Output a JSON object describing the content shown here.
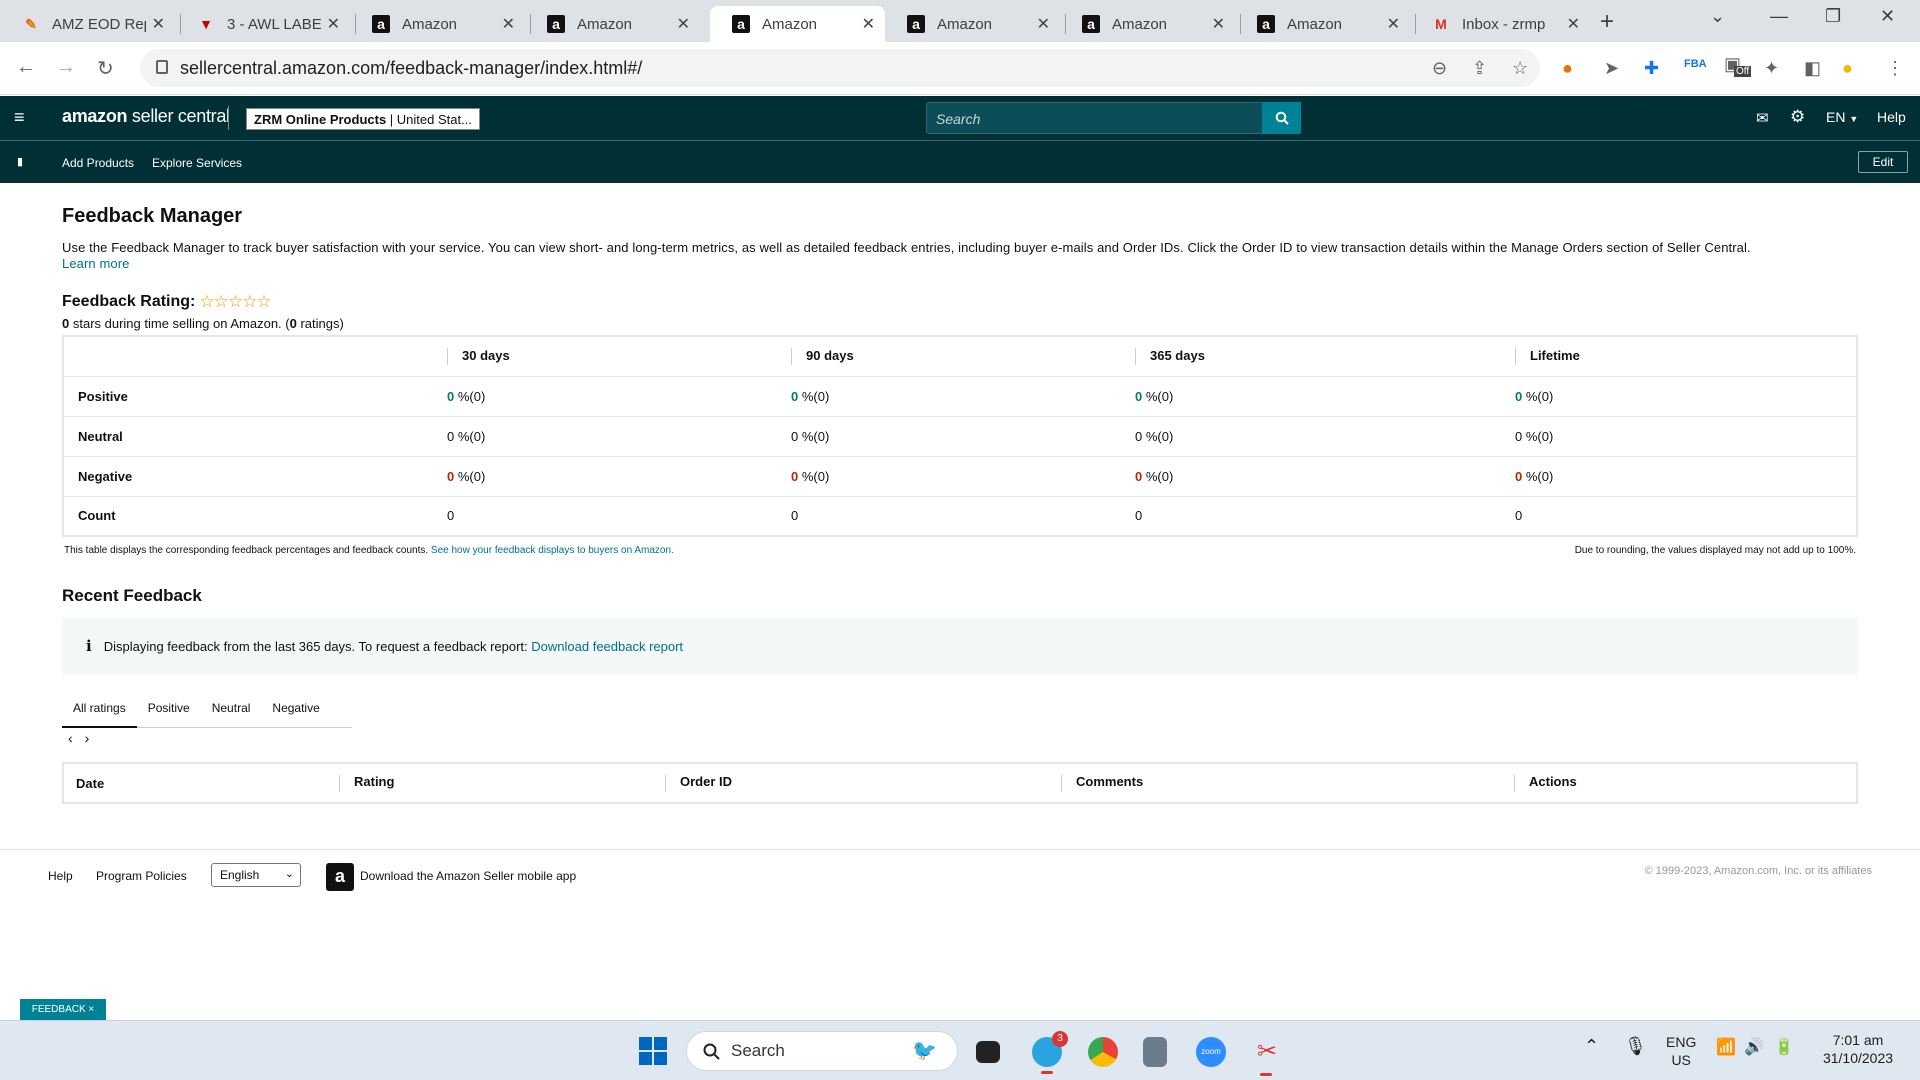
{
  "browser": {
    "tabs": [
      {
        "label": "AMZ EOD Rep",
        "icon": "tab-tool-icon"
      },
      {
        "label": "3 - AWL LABE",
        "icon": "tab-v-icon"
      },
      {
        "label": "Amazon",
        "icon": "amazon-icon"
      },
      {
        "label": "Amazon",
        "icon": "amazon-icon"
      },
      {
        "label": "Amazon",
        "icon": "amazon-icon"
      },
      {
        "label": "Amazon",
        "icon": "amazon-icon"
      },
      {
        "label": "Amazon",
        "icon": "amazon-icon"
      },
      {
        "label": "Amazon",
        "icon": "amazon-icon"
      },
      {
        "label": "Inbox - zrmp",
        "icon": "gmail-icon"
      }
    ],
    "active_tab": 4,
    "url": "sellercentral.amazon.com/feedback-manager/index.html#/",
    "extension_off_label": "Off"
  },
  "header": {
    "logo_a": "amazon",
    "logo_b": " seller central",
    "store_name": "ZRM Online Products",
    "store_region": " | United Stat...",
    "search_placeholder": "Search",
    "lang": "EN",
    "help": "Help"
  },
  "subnav": {
    "items": [
      "Add Products",
      "Explore Services"
    ],
    "edit": "Edit"
  },
  "page": {
    "title": "Feedback Manager",
    "intro": "Use the Feedback Manager to track buyer satisfaction with your service. You can view short- and long-term metrics, as well as detailed feedback entries, including buyer e-mails and Order IDs. Click the Order ID to view transaction details within the Manage Orders section of Seller Central.",
    "learn_more": "Learn more",
    "rating_label": "Feedback Rating:",
    "rating_stars": 0,
    "stars_num": "0",
    "stars_text": " stars during time selling on Amazon. (",
    "ratings_num": "0",
    "ratings_text": " ratings)",
    "table": {
      "columns": [
        "",
        "30 days",
        "90 days",
        "365 days",
        "Lifetime"
      ],
      "rows": [
        {
          "label": "Positive",
          "num": "0",
          "pct": " %(0)"
        },
        {
          "label": "Neutral",
          "num": "0",
          "pct": " %(0)"
        },
        {
          "label": "Negative",
          "num": "0",
          "pct": " %(0)"
        },
        {
          "label": "Count",
          "num": "0",
          "pct": ""
        }
      ]
    },
    "note_left": "This table displays the corresponding feedback percentages and feedback counts.",
    "note_link": "See how your feedback displays to buyers on Amazon.",
    "note_right": "Due to rounding, the values displayed may not add up to 100%.",
    "recent_title": "Recent Feedback",
    "info_text": "Displaying feedback from the last 365 days. To request a feedback report:",
    "info_link": "Download feedback report",
    "rating_tabs": [
      "All ratings",
      "Positive",
      "Neutral",
      "Negative"
    ],
    "recent_columns": [
      "Date",
      "Rating",
      "Order ID",
      "Comments",
      "Actions"
    ]
  },
  "footer": {
    "help": "Help",
    "policies": "Program Policies",
    "language": "English",
    "app_text": "Download the Amazon Seller mobile app",
    "copyright": "© 1999-2023, Amazon.com, Inc. or its affiliates",
    "feedback_tag": "FEEDBACK ×"
  },
  "taskbar": {
    "search": "Search",
    "telegram_badge": "3",
    "lang_top": "ENG",
    "lang_bottom": "US",
    "time": "7:01 am",
    "date": "31/10/2023",
    "zoom_label": "zoom"
  },
  "colors": {
    "header_bg": "#002f36",
    "teal": "#008296",
    "positive": "#067d62",
    "negative": "#b12704"
  }
}
